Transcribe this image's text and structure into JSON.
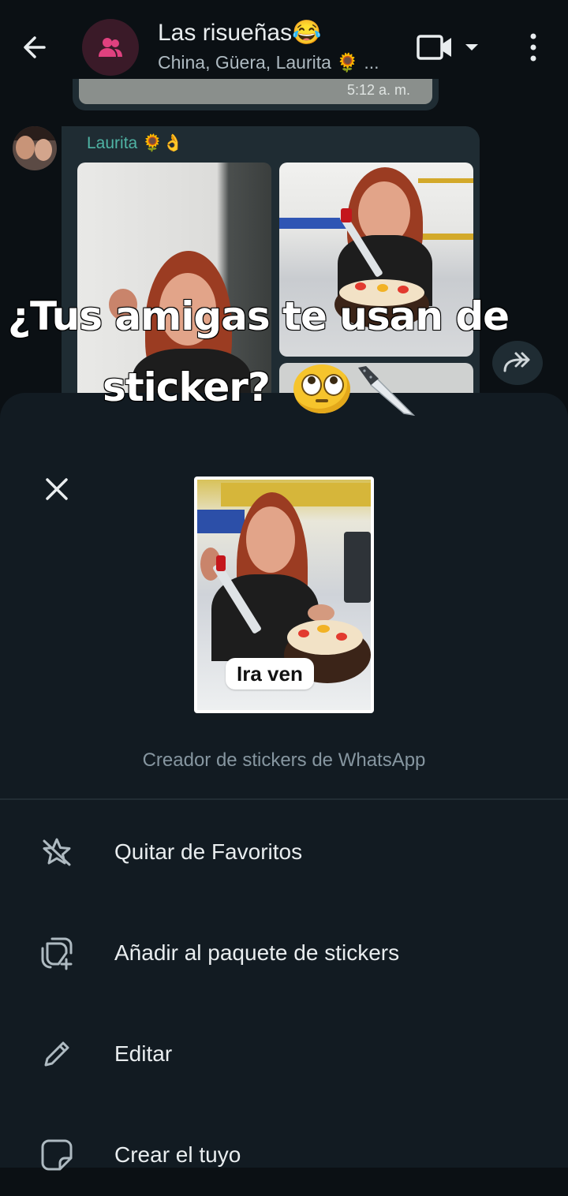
{
  "header": {
    "title": "Las risueñas😂",
    "subtitle": "China, Güera, Laurita 🌻 ..."
  },
  "chat": {
    "previous_time": "5:12 a. m.",
    "sender_name": "Laurita 🌻👌"
  },
  "overlay_caption": {
    "line1": "¿Tus amigas te usan de",
    "line2": "sticker?"
  },
  "sheet": {
    "sticker_text": "Ira ven",
    "source_label": "Creador de stickers de WhatsApp",
    "options": [
      {
        "label": "Quitar de Favoritos",
        "icon": "star-off-icon"
      },
      {
        "label": "Añadir al paquete de stickers",
        "icon": "sticker-add-icon"
      },
      {
        "label": "Editar",
        "icon": "pencil-icon"
      },
      {
        "label": "Crear el tuyo",
        "icon": "sticker-create-icon"
      }
    ]
  },
  "colors": {
    "background": "#0b1014",
    "sheet": "#121b22",
    "bubble": "#1f2c33",
    "sender_name": "#4fb3a4"
  }
}
